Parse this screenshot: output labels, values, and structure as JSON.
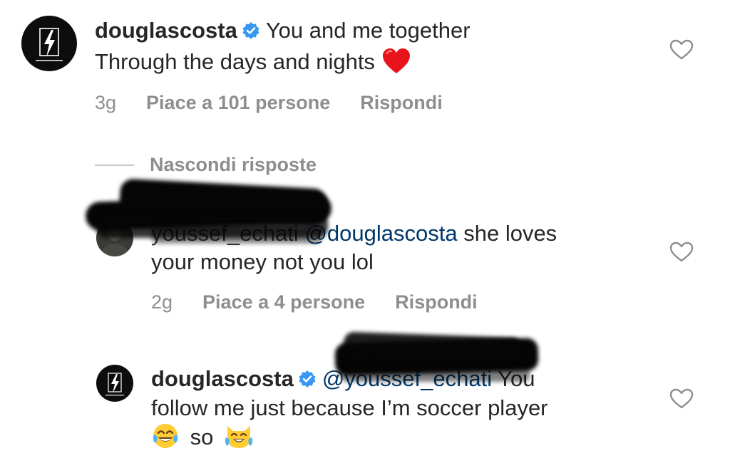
{
  "comments": [
    {
      "username": "douglascosta",
      "verified": true,
      "text_line1": "You and me together",
      "text_line2": "Through the days and nights",
      "time": "3g",
      "likes": "Piace a 101 persone",
      "reply": "Rispondi",
      "emoji": "red-heart"
    },
    {
      "username": "youssef_echati",
      "mention": "@douglascosta",
      "text_line1": "she loves",
      "text_line2": "your money  not you lol",
      "time": "2g",
      "likes": "Piace a 4 persone",
      "reply": "Rispondi"
    },
    {
      "username": "douglascosta",
      "verified": true,
      "mention": "@youssef_echati",
      "text_line1": "You",
      "text_line2": "follow me just because I’m soccer player",
      "text_line3": "so",
      "emojis": [
        "face-with-tears-of-joy",
        "cat-with-tears-of-joy"
      ]
    }
  ],
  "thread": {
    "hide_replies": "Nascondi risposte"
  },
  "colors": {
    "verified": "#3897f0",
    "mention": "#00376b",
    "meta": "#8e8e8e",
    "heart_outline": "#8e8e8e"
  }
}
